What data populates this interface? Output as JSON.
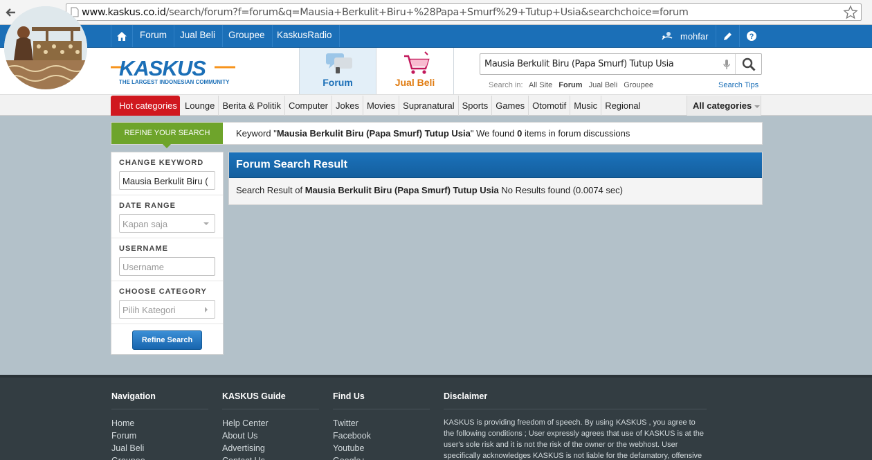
{
  "browser": {
    "url_prefix": "www.kaskus.co.id",
    "url_rest": "/search/forum?f=forum&q=Mausia+Berkulit+Biru+%28Papa+Smurf%29+Tutup+Usia&searchchoice=forum"
  },
  "topnav": {
    "items": [
      {
        "label": "Forum"
      },
      {
        "label": "Jual Beli"
      },
      {
        "label": "Groupee"
      },
      {
        "label": "KaskusRadio"
      }
    ],
    "username": "mohfar"
  },
  "header": {
    "logo_tagline": "THE LARGEST INDONESIAN COMMUNITY",
    "tabs": [
      {
        "label": "Forum"
      },
      {
        "label": "Jual Beli"
      }
    ],
    "search_value": "Mausia Berkulit Biru (Papa Smurf) Tutup Usia",
    "search_in_label": "Search in:",
    "search_in_options": [
      "All Site",
      "Forum",
      "Jual Beli",
      "Groupee"
    ],
    "search_tips": "Search Tips"
  },
  "categories": {
    "hot": "Hot categories",
    "items": [
      "Lounge",
      "Berita & Politik",
      "Computer",
      "Jokes",
      "Movies",
      "Supranatural",
      "Sports",
      "Games",
      "Otomotif",
      "Music",
      "Regional"
    ],
    "all": "All categories"
  },
  "refine_bar": {
    "label": "REFINE YOUR SEARCH",
    "msg_pre": "Keyword \"",
    "keyword": "Mausia Berkulit Biru (Papa Smurf) Tutup Usia",
    "msg_mid": "\" We found ",
    "count": "0",
    "msg_post": " items in forum discussions"
  },
  "sidebar": {
    "keyword_label": "CHANGE KEYWORD",
    "keyword_value": "Mausia Berkulit Biru (",
    "date_label": "DATE RANGE",
    "date_value": "Kapan saja",
    "username_label": "USERNAME",
    "username_placeholder": "Username",
    "category_label": "CHOOSE CATEGORY",
    "category_value": "Pilih Kategori",
    "button": "Refine Search"
  },
  "result": {
    "title": "Forum Search Result",
    "pre": "Search Result of ",
    "keyword": "Mausia Berkulit Biru (Papa Smurf) Tutup Usia",
    "post": " No Results found (0.0074 sec)"
  },
  "footer": {
    "navigation": {
      "title": "Navigation",
      "links": [
        "Home",
        "Forum",
        "Jual Beli",
        "Groupee"
      ]
    },
    "guide": {
      "title": "KASKUS Guide",
      "links": [
        "Help Center",
        "About Us",
        "Advertising",
        "Contact Us"
      ]
    },
    "findus": {
      "title": "Find Us",
      "links": [
        "Twitter",
        "Facebook",
        "Youtube",
        "Google+"
      ]
    },
    "disclaimer": {
      "title": "Disclaimer",
      "text": "KASKUS is providing freedom of speech. By using KASKUS , you agree to the following conditions ; User expressly agrees that use of KASKUS is at the user's sole risk and it is not the risk of the owner or the webhost. User specifically acknowledges KASKUS is not liable for the defamatory, offensive"
    }
  },
  "colors": {
    "topbar": "#1b6fb7",
    "hot": "#d0181f",
    "refine_green": "#6ea42b",
    "footer": "#333d42"
  }
}
